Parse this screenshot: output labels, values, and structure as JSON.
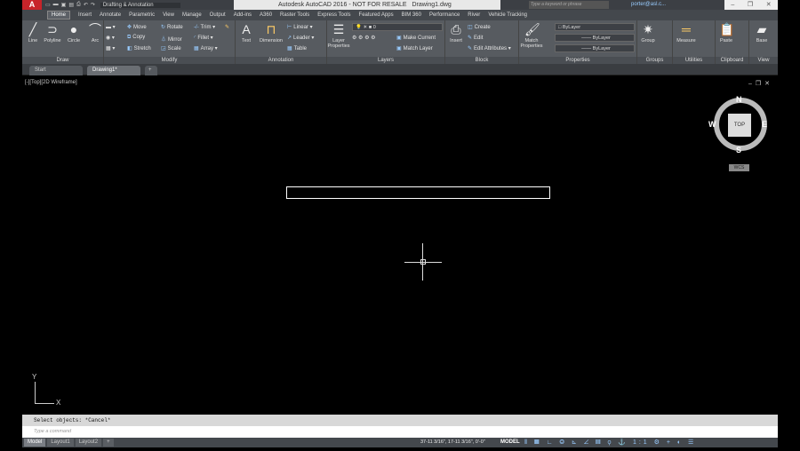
{
  "title_bar": {
    "app_title": "Autodesk AutoCAD 2016 - NOT FOR RESALE",
    "file_name": "Drawing1.dwg",
    "workspace": "Drafting & Annotation",
    "search_placeholder": "Type a keyword or phrase",
    "user": "porter@asl.c...",
    "logo": "A"
  },
  "ribbon_tabs": [
    "Home",
    "Insert",
    "Annotate",
    "Parametric",
    "View",
    "Manage",
    "Output",
    "Add-ins",
    "A360",
    "Raster Tools",
    "Express Tools",
    "Featured Apps",
    "BIM 360",
    "Performance",
    "River",
    "Vehicle Tracking"
  ],
  "panels": {
    "draw": {
      "title": "Draw",
      "tools": [
        "Line",
        "Polyline",
        "Circle",
        "Arc"
      ]
    },
    "modify": {
      "title": "Modify",
      "tools": [
        "Move",
        "Rotate",
        "Trim",
        "Copy",
        "Mirror",
        "Fillet",
        "Stretch",
        "Scale",
        "Array"
      ]
    },
    "annotation": {
      "title": "Annotation",
      "tools": [
        "Text",
        "Dimension",
        "Linear",
        "Leader",
        "Table"
      ]
    },
    "layers": {
      "title": "Layers",
      "tools": [
        "Layer Properties",
        "Make Current",
        "Match Layer"
      ],
      "layer_value": "0"
    },
    "block": {
      "title": "Block",
      "tools": [
        "Insert",
        "Create",
        "Edit",
        "Edit Attributes"
      ]
    },
    "properties": {
      "title": "Properties",
      "tools": [
        "Match Properties"
      ],
      "color": "ByLayer",
      "linetype": "ByLayer",
      "lineweight": "ByLayer"
    },
    "groups": {
      "title": "Groups",
      "tools": [
        "Group"
      ]
    },
    "utilities": {
      "title": "Utilities",
      "tools": [
        "Measure"
      ]
    },
    "clipboard": {
      "title": "Clipboard",
      "tools": [
        "Paste"
      ]
    },
    "view": {
      "title": "View",
      "tools": [
        "Base"
      ]
    }
  },
  "file_tabs": [
    "Start",
    "Drawing1*"
  ],
  "viewport": {
    "label": "[-][Top][2D Wireframe]",
    "viewcube": {
      "top": "TOP",
      "north": "N",
      "south": "S",
      "east": "E",
      "west": "W",
      "ucs": "WCS"
    },
    "ucs_x": "X",
    "ucs_y": "Y"
  },
  "command_line": {
    "history": "Select objects: *Cancel*",
    "placeholder": "Type a command"
  },
  "layout_tabs": [
    "Model",
    "Layout1",
    "Layout2"
  ],
  "status_bar": {
    "coordinates": "37-11 3/16\", 17-11 3/16\", 0'-0\"",
    "mode": "MODEL",
    "scale": "1:1"
  }
}
